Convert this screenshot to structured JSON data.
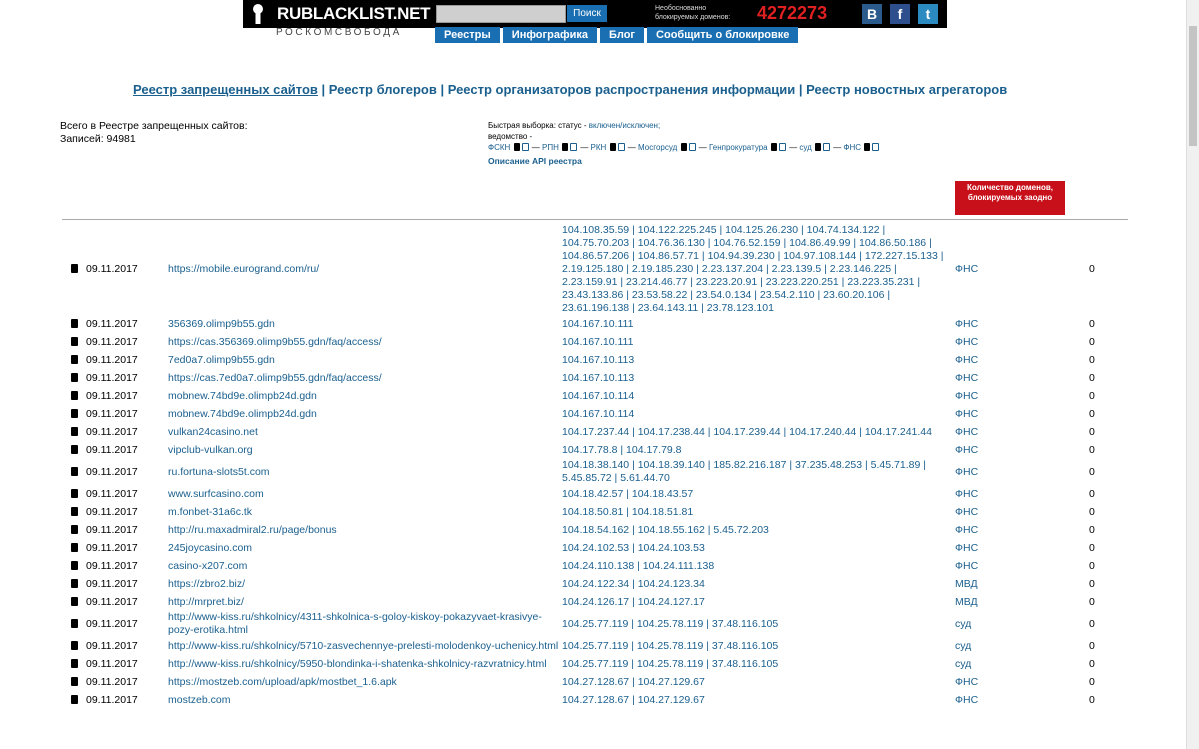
{
  "header": {
    "logo": "RUBLACKLIST.NET",
    "subtitle": "РОСКОМСВОБОДА",
    "search_button": "Поиск",
    "search_placeholder": "",
    "blocked_label": "Необоснованно блокируемых доменов:",
    "blocked_count": "4272273",
    "social": [
      "B",
      "f",
      "t"
    ],
    "nav": [
      "Реестры",
      "Инфографика",
      "Блог",
      "Сообщить о блокировке"
    ]
  },
  "registries": {
    "first": "Реестр запрещенных сайтов",
    "second": "Реестр блогеров",
    "third": "Реестр организаторов распространения информации",
    "fourth": "Реестр новостных агрегаторов"
  },
  "totals": {
    "line1": "Всего в Реестре запрещенных сайтов:",
    "line2": "Записей: 94981"
  },
  "filters": {
    "quick_label": "Быстрая выборка: статус - ",
    "status_link": "включен/исключен;",
    "dept_label": "ведомство -",
    "depts": [
      "ФСКН",
      "РПН",
      "РКН",
      "Мосгорсуд",
      "Генпрокуратура",
      "суд",
      "ФНС"
    ],
    "api": "Описание API реестра"
  },
  "red_badge": "Количество доменов, блокируемых заодно",
  "rows": [
    {
      "date": "09.11.2017",
      "url": "https://mobile.eurogrand.com/ru/",
      "ips": "104.108.35.59 | 104.122.225.245 | 104.125.26.230 | 104.74.134.122 | 104.75.70.203 | 104.76.36.130 | 104.76.52.159 | 104.86.49.99 | 104.86.50.186 | 104.86.57.206 | 104.86.57.71 | 104.94.39.230 | 104.97.108.144 | 172.227.15.133 | 2.19.125.180 | 2.19.185.230 | 2.23.137.204 | 2.23.139.5 | 2.23.146.225 | 2.23.159.91 | 23.214.46.77 | 23.223.20.91 | 23.223.220.251 | 23.223.35.231 | 23.43.133.86 | 23.53.58.22 | 23.54.0.134 | 23.54.2.110 | 23.60.20.106 | 23.61.196.138 | 23.64.143.11 | 23.78.123.101",
      "org": "ФНС",
      "count": "0"
    },
    {
      "date": "09.11.2017",
      "url": "356369.olimp9b55.gdn",
      "ips": "104.167.10.111",
      "org": "ФНС",
      "count": "0"
    },
    {
      "date": "09.11.2017",
      "url": "https://cas.356369.olimp9b55.gdn/faq/access/",
      "ips": "104.167.10.111",
      "org": "ФНС",
      "count": "0"
    },
    {
      "date": "09.11.2017",
      "url": "7ed0a7.olimp9b55.gdn",
      "ips": "104.167.10.113",
      "org": "ФНС",
      "count": "0"
    },
    {
      "date": "09.11.2017",
      "url": "https://cas.7ed0a7.olimp9b55.gdn/faq/access/",
      "ips": "104.167.10.113",
      "org": "ФНС",
      "count": "0"
    },
    {
      "date": "09.11.2017",
      "url": "mobnew.74bd9e.olimpb24d.gdn",
      "ips": "104.167.10.114",
      "org": "ФНС",
      "count": "0"
    },
    {
      "date": "09.11.2017",
      "url": "mobnew.74bd9e.olimpb24d.gdn",
      "ips": "104.167.10.114",
      "org": "ФНС",
      "count": "0"
    },
    {
      "date": "09.11.2017",
      "url": "vulkan24casino.net",
      "ips": "104.17.237.44 | 104.17.238.44 | 104.17.239.44 | 104.17.240.44 | 104.17.241.44",
      "org": "ФНС",
      "count": "0"
    },
    {
      "date": "09.11.2017",
      "url": "vipclub-vulkan.org",
      "ips": "104.17.78.8 | 104.17.79.8",
      "org": "ФНС",
      "count": "0"
    },
    {
      "date": "09.11.2017",
      "url": "ru.fortuna-slots5t.com",
      "ips": "104.18.38.140 | 104.18.39.140 | 185.82.216.187 | 37.235.48.253 | 5.45.71.89 | 5.45.85.72 | 5.61.44.70",
      "org": "ФНС",
      "count": "0"
    },
    {
      "date": "09.11.2017",
      "url": "www.surfcasino.com",
      "ips": "104.18.42.57 | 104.18.43.57",
      "org": "ФНС",
      "count": "0"
    },
    {
      "date": "09.11.2017",
      "url": "m.fonbet-31a6c.tk",
      "ips": "104.18.50.81 | 104.18.51.81",
      "org": "ФНС",
      "count": "0"
    },
    {
      "date": "09.11.2017",
      "url": "http://ru.maxadmiral2.ru/page/bonus",
      "ips": "104.18.54.162 | 104.18.55.162 | 5.45.72.203",
      "org": "ФНС",
      "count": "0"
    },
    {
      "date": "09.11.2017",
      "url": "245joycasino.com",
      "ips": "104.24.102.53 | 104.24.103.53",
      "org": "ФНС",
      "count": "0"
    },
    {
      "date": "09.11.2017",
      "url": "casino-x207.com",
      "ips": "104.24.110.138 | 104.24.111.138",
      "org": "ФНС",
      "count": "0"
    },
    {
      "date": "09.11.2017",
      "url": "https://zbro2.biz/",
      "ips": "104.24.122.34 | 104.24.123.34",
      "org": "МВД",
      "count": "0"
    },
    {
      "date": "09.11.2017",
      "url": "http://mrpret.biz/",
      "ips": "104.24.126.17 | 104.24.127.17",
      "org": "МВД",
      "count": "0"
    },
    {
      "date": "09.11.2017",
      "url": "http://www-kiss.ru/shkolnicy/4311-shkolnica-s-goloy-kiskoy-pokazyvaet-krasivye-pozy-erotika.html",
      "ips": "104.25.77.119 | 104.25.78.119 | 37.48.116.105",
      "org": "суд",
      "count": "0"
    },
    {
      "date": "09.11.2017",
      "url": "http://www-kiss.ru/shkolnicy/5710-zasvechennye-prelesti-molodenkoy-uchenicy.html",
      "ips": "104.25.77.119 | 104.25.78.119 | 37.48.116.105",
      "org": "суд",
      "count": "0"
    },
    {
      "date": "09.11.2017",
      "url": "http://www-kiss.ru/shkolnicy/5950-blondinka-i-shatenka-shkolnicy-razvratnicy.html",
      "ips": "104.25.77.119 | 104.25.78.119 | 37.48.116.105",
      "org": "суд",
      "count": "0"
    },
    {
      "date": "09.11.2017",
      "url": "https://mostzeb.com/upload/apk/mostbet_1.6.apk",
      "ips": "104.27.128.67 | 104.27.129.67",
      "org": "ФНС",
      "count": "0"
    },
    {
      "date": "09.11.2017",
      "url": "mostzeb.com",
      "ips": "104.27.128.67 | 104.27.129.67",
      "org": "ФНС",
      "count": "0"
    }
  ]
}
